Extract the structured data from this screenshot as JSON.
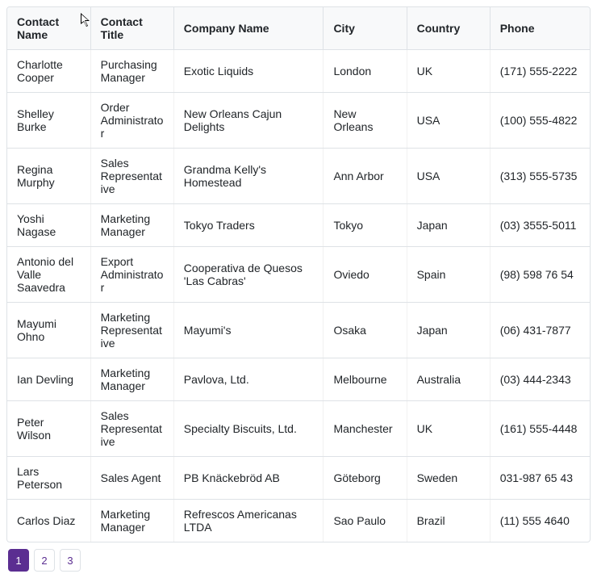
{
  "columns": [
    {
      "key": "name",
      "label": "Contact Name"
    },
    {
      "key": "title",
      "label": "Contact Title"
    },
    {
      "key": "company",
      "label": "Company Name"
    },
    {
      "key": "city",
      "label": "City"
    },
    {
      "key": "country",
      "label": "Country"
    },
    {
      "key": "phone",
      "label": "Phone"
    }
  ],
  "rows": [
    {
      "name": "Charlotte Cooper",
      "title": "Purchasing Manager",
      "company": "Exotic Liquids",
      "city": "London",
      "country": "UK",
      "phone": "(171) 555-2222"
    },
    {
      "name": "Shelley Burke",
      "title": "Order Administrator",
      "company": "New Orleans Cajun Delights",
      "city": "New Orleans",
      "country": "USA",
      "phone": "(100) 555-4822"
    },
    {
      "name": "Regina Murphy",
      "title": "Sales Representative",
      "company": "Grandma Kelly's Homestead",
      "city": "Ann Arbor",
      "country": "USA",
      "phone": "(313) 555-5735"
    },
    {
      "name": "Yoshi Nagase",
      "title": "Marketing Manager",
      "company": "Tokyo Traders",
      "city": "Tokyo",
      "country": "Japan",
      "phone": "(03) 3555-5011"
    },
    {
      "name": "Antonio del Valle Saavedra",
      "title": "Export Administrator",
      "company": "Cooperativa de Quesos 'Las Cabras'",
      "city": "Oviedo",
      "country": "Spain",
      "phone": "(98) 598 76 54"
    },
    {
      "name": "Mayumi Ohno",
      "title": "Marketing Representative",
      "company": "Mayumi's",
      "city": "Osaka",
      "country": "Japan",
      "phone": "(06) 431-7877"
    },
    {
      "name": "Ian Devling",
      "title": "Marketing Manager",
      "company": "Pavlova, Ltd.",
      "city": "Melbourne",
      "country": "Australia",
      "phone": "(03) 444-2343"
    },
    {
      "name": "Peter Wilson",
      "title": "Sales Representative",
      "company": "Specialty Biscuits, Ltd.",
      "city": "Manchester",
      "country": "UK",
      "phone": "(161) 555-4448"
    },
    {
      "name": "Lars Peterson",
      "title": "Sales Agent",
      "company": "PB Knäckebröd AB",
      "city": "Göteborg",
      "country": "Sweden",
      "phone": "031-987 65 43"
    },
    {
      "name": "Carlos Diaz",
      "title": "Marketing Manager",
      "company": "Refrescos Americanas LTDA",
      "city": "Sao Paulo",
      "country": "Brazil",
      "phone": "(11) 555 4640"
    }
  ],
  "pager": {
    "pages": [
      "1",
      "2",
      "3"
    ],
    "current": 1
  },
  "colors": {
    "accent": "#5b2e91"
  }
}
